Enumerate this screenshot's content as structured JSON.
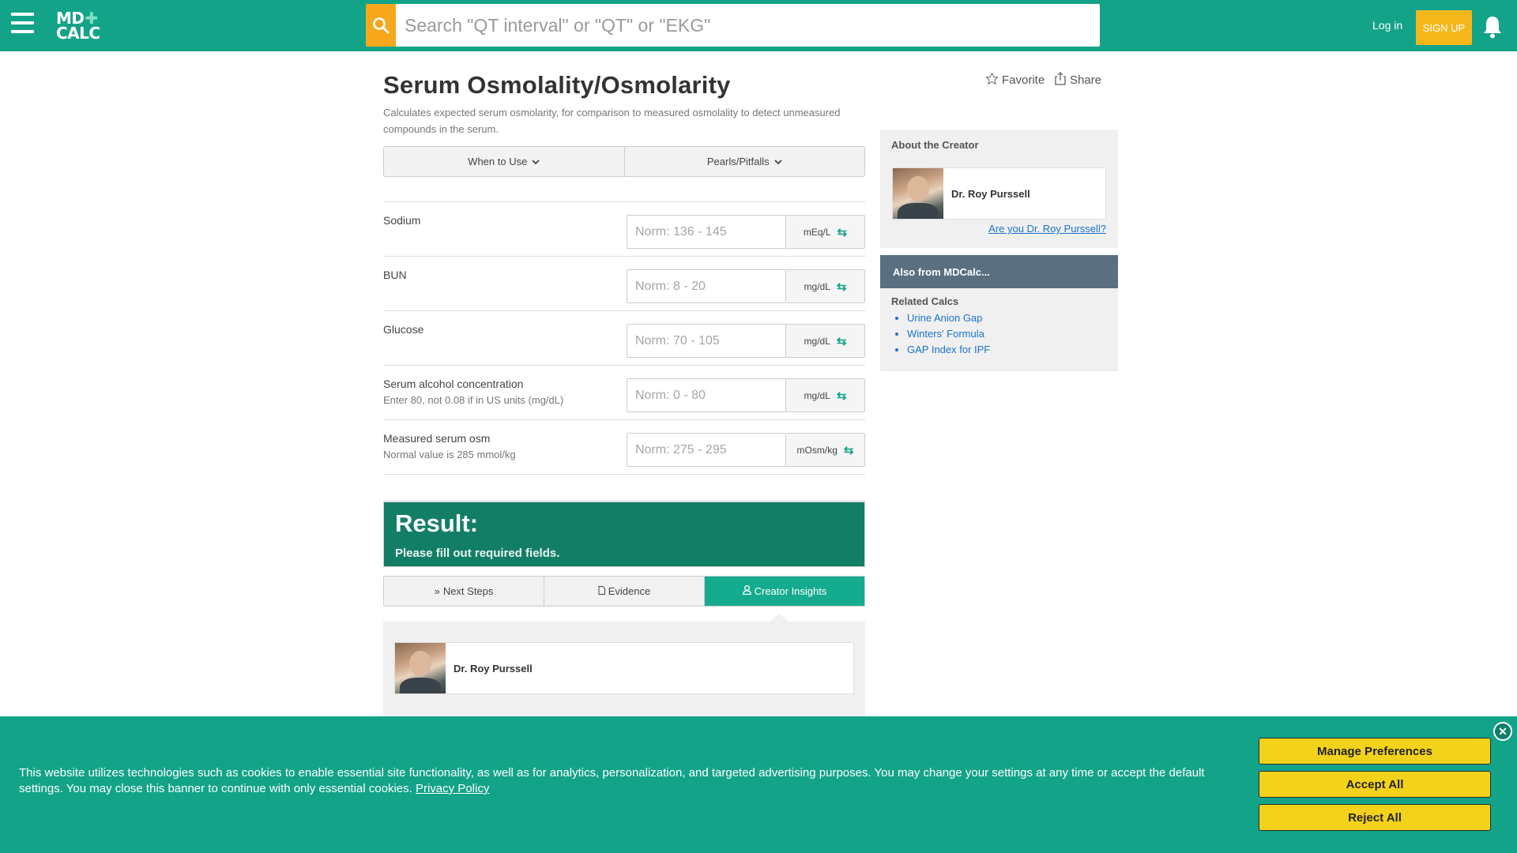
{
  "header": {
    "search_placeholder": "Search \"QT interval\" or \"QT\" or \"EKG\"",
    "login_label": "Log in",
    "signup_label": "SIGN UP",
    "logo_line1": "MD",
    "logo_line2": "CALC"
  },
  "calc": {
    "title": "Serum Osmolality/Osmolarity",
    "subtitle": "Calculates expected serum osmolarity, for comparison to measured osmolality to detect unmeasured compounds in the serum.",
    "favorite_label": "Favorite",
    "share_label": "Share",
    "accordion": [
      "When to Use",
      "Pearls/Pitfalls"
    ]
  },
  "fields": [
    {
      "label": "Sodium",
      "hint": "",
      "placeholder": "Norm: 136 - 145",
      "unit": "mEq/L"
    },
    {
      "label": "BUN",
      "hint": "",
      "placeholder": "Norm: 8 - 20",
      "unit": "mg/dL"
    },
    {
      "label": "Glucose",
      "hint": "",
      "placeholder": "Norm: 70 - 105",
      "unit": "mg/dL"
    },
    {
      "label": "Serum alcohol concentration",
      "hint": "Enter 80, not 0.08 if in US units (mg/dL)",
      "placeholder": "Norm: 0 - 80",
      "unit": "mg/dL"
    },
    {
      "label": "Measured serum osm",
      "hint": "Normal value is 285 mmol/kg",
      "placeholder": "Norm: 275 - 295",
      "unit": "mOsm/kg"
    }
  ],
  "result": {
    "title": "Result:",
    "message": "Please fill out required fields."
  },
  "tabs": [
    {
      "label": "Next Steps",
      "icon": "double-chevron-right-icon",
      "active": false
    },
    {
      "label": "Evidence",
      "icon": "document-icon",
      "active": false
    },
    {
      "label": "Creator Insights",
      "icon": "person-icon",
      "active": true
    }
  ],
  "creator": {
    "name": "Dr. Roy Purssell"
  },
  "sidebar": {
    "about_title": "About the Creator",
    "creator_name": "Dr. Roy Purssell",
    "claim_link": "Are you Dr. Roy Purssell?",
    "also_title": "Also from MDCalc...",
    "related_title": "Related Calcs",
    "related": [
      "Urine Anion Gap",
      "Winters' Formula",
      "GAP Index for IPF"
    ]
  },
  "cookie": {
    "text": "This website utilizes technologies such as cookies to enable essential site functionality, as well as for analytics, personalization, and targeted advertising purposes. You may change your settings at any time or accept the default settings. You may close this banner to continue with only essential cookies.",
    "privacy_link": "Privacy Policy",
    "buttons": [
      "Manage Preferences",
      "Accept All",
      "Reject All"
    ]
  },
  "colors": {
    "brand_green": "#13a389",
    "result_green": "#137e66",
    "search_orange": "#f6a71b",
    "cookie_button": "#f3d21b",
    "sidebar_header": "#5a6f80",
    "link_blue": "#1a73c8"
  }
}
